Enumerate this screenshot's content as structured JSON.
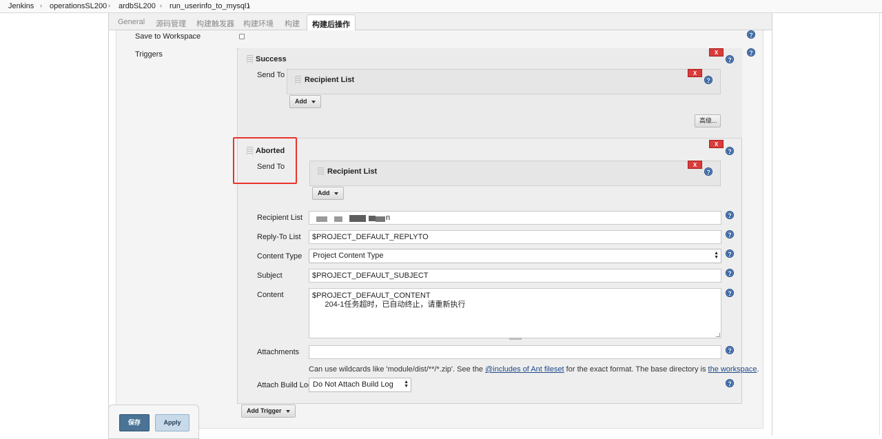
{
  "breadcrumb": [
    "Jenkins",
    "operationsSL200",
    "ardbSL200",
    "run_userinfo_to_mysql1"
  ],
  "tabs": [
    "General",
    "源码管理",
    "构建触发器",
    "构建环境",
    "构建",
    "构建后操作"
  ],
  "active_tab": "构建后操作",
  "form": {
    "save_to_workspace": "Save to Workspace",
    "save_to_workspace_checked": false,
    "triggers_label": "Triggers",
    "success": {
      "title": "Success",
      "send_to": "Send To",
      "recipient_list": "Recipient List",
      "add": "Add",
      "advanced": "高级..."
    },
    "aborted": {
      "title": "Aborted",
      "send_to": "Send To",
      "recipient_list_block": "Recipient List",
      "add": "Add",
      "fields": {
        "recipient_list_label": "Recipient List",
        "recipient_list_value_tail": "n",
        "reply_to_label": "Reply-To List",
        "reply_to_value": "$PROJECT_DEFAULT_REPLYTO",
        "content_type_label": "Content Type",
        "content_type_value": "Project Content Type",
        "subject_label": "Subject",
        "subject_value": "$PROJECT_DEFAULT_SUBJECT",
        "content_label": "Content",
        "content_value": "$PROJECT_DEFAULT_CONTENT\n      204-1任务超时，已自动终止，请重新执行",
        "attachments_label": "Attachments",
        "attachments_value": "",
        "attachments_hint_pre": "Can use wildcards like 'module/dist/**/*.zip'. See the ",
        "attachments_hint_link1": "@includes of Ant fileset",
        "attachments_hint_mid": " for the exact format. The base directory is ",
        "attachments_hint_link2": "the workspace",
        "attachments_hint_post": ".",
        "attach_build_log_label": "Attach Build Log",
        "attach_build_log_value": "Do Not Attach Build Log"
      }
    },
    "add_trigger": "Add Trigger",
    "remove": "X",
    "help": "?"
  },
  "buttons": {
    "save": "保存",
    "apply": "Apply"
  }
}
